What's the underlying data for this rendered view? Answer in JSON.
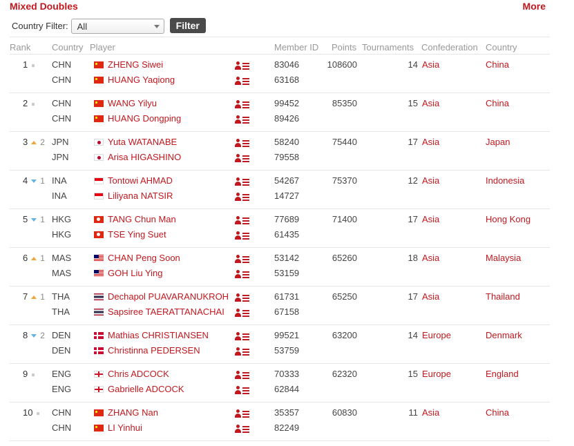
{
  "header": {
    "title": "Mixed Doubles",
    "more_link": "More"
  },
  "filter": {
    "label": "Country Filter:",
    "selected": "All",
    "button": "Filter"
  },
  "columns": {
    "rank": "Rank",
    "country": "Country",
    "player": "Player",
    "member_id": "Member ID",
    "points": "Points",
    "tournaments": "Tournaments",
    "confederation": "Confederation",
    "country_name": "Country"
  },
  "rows": [
    {
      "rank": "1",
      "movement": "",
      "move_dir": "none",
      "points": "108600",
      "tournaments": "14",
      "confederation": "Asia",
      "country_name": "China",
      "players": [
        {
          "code": "CHN",
          "flag": "flag-chn",
          "name": "ZHENG Siwei",
          "member_id": "83046"
        },
        {
          "code": "CHN",
          "flag": "flag-chn",
          "name": "HUANG Yaqiong",
          "member_id": "63168"
        }
      ]
    },
    {
      "rank": "2",
      "movement": "",
      "move_dir": "none",
      "points": "85350",
      "tournaments": "15",
      "confederation": "Asia",
      "country_name": "China",
      "players": [
        {
          "code": "CHN",
          "flag": "flag-chn",
          "name": "WANG Yilyu",
          "member_id": "99452"
        },
        {
          "code": "CHN",
          "flag": "flag-chn",
          "name": "HUANG Dongping",
          "member_id": "89426"
        }
      ]
    },
    {
      "rank": "3",
      "movement": "2",
      "move_dir": "up",
      "points": "75440",
      "tournaments": "17",
      "confederation": "Asia",
      "country_name": "Japan",
      "players": [
        {
          "code": "JPN",
          "flag": "flag-jpn",
          "name": "Yuta WATANABE",
          "member_id": "58240"
        },
        {
          "code": "JPN",
          "flag": "flag-jpn",
          "name": "Arisa HIGASHINO",
          "member_id": "79558"
        }
      ]
    },
    {
      "rank": "4",
      "movement": "1",
      "move_dir": "down",
      "points": "75370",
      "tournaments": "12",
      "confederation": "Asia",
      "country_name": "Indonesia",
      "players": [
        {
          "code": "INA",
          "flag": "flag-ina",
          "name": "Tontowi AHMAD",
          "member_id": "54267"
        },
        {
          "code": "INA",
          "flag": "flag-ina",
          "name": "Liliyana NATSIR",
          "member_id": "14727"
        }
      ]
    },
    {
      "rank": "5",
      "movement": "1",
      "move_dir": "down",
      "points": "71400",
      "tournaments": "17",
      "confederation": "Asia",
      "country_name": "Hong Kong",
      "players": [
        {
          "code": "HKG",
          "flag": "flag-hkg",
          "name": "TANG Chun Man",
          "member_id": "77689"
        },
        {
          "code": "HKG",
          "flag": "flag-hkg",
          "name": "TSE Ying Suet",
          "member_id": "61435"
        }
      ]
    },
    {
      "rank": "6",
      "movement": "1",
      "move_dir": "up",
      "points": "65260",
      "tournaments": "18",
      "confederation": "Asia",
      "country_name": "Malaysia",
      "players": [
        {
          "code": "MAS",
          "flag": "flag-mas",
          "name": "CHAN Peng Soon",
          "member_id": "53142"
        },
        {
          "code": "MAS",
          "flag": "flag-mas",
          "name": "GOH Liu Ying",
          "member_id": "53159"
        }
      ]
    },
    {
      "rank": "7",
      "movement": "1",
      "move_dir": "up",
      "points": "65250",
      "tournaments": "17",
      "confederation": "Asia",
      "country_name": "Thailand",
      "players": [
        {
          "code": "THA",
          "flag": "flag-tha",
          "name": "Dechapol PUAVARANUKROH",
          "member_id": "61731"
        },
        {
          "code": "THA",
          "flag": "flag-tha",
          "name": "Sapsiree TAERATTANACHAI",
          "member_id": "67158"
        }
      ]
    },
    {
      "rank": "8",
      "movement": "2",
      "move_dir": "down",
      "points": "63200",
      "tournaments": "14",
      "confederation": "Europe",
      "country_name": "Denmark",
      "players": [
        {
          "code": "DEN",
          "flag": "flag-den",
          "name": "Mathias CHRISTIANSEN",
          "member_id": "99521"
        },
        {
          "code": "DEN",
          "flag": "flag-den",
          "name": "Christinna PEDERSEN",
          "member_id": "53759"
        }
      ]
    },
    {
      "rank": "9",
      "movement": "",
      "move_dir": "none",
      "points": "62320",
      "tournaments": "15",
      "confederation": "Europe",
      "country_name": "England",
      "players": [
        {
          "code": "ENG",
          "flag": "flag-eng",
          "name": "Chris ADCOCK",
          "member_id": "70333"
        },
        {
          "code": "ENG",
          "flag": "flag-eng",
          "name": "Gabrielle ADCOCK",
          "member_id": "62844"
        }
      ]
    },
    {
      "rank": "10",
      "movement": "",
      "move_dir": "none",
      "points": "60830",
      "tournaments": "11",
      "confederation": "Asia",
      "country_name": "China",
      "players": [
        {
          "code": "CHN",
          "flag": "flag-chn",
          "name": "ZHANG Nan",
          "member_id": "35357"
        },
        {
          "code": "CHN",
          "flag": "flag-chn",
          "name": "LI Yinhui",
          "member_id": "82249"
        }
      ]
    }
  ]
}
